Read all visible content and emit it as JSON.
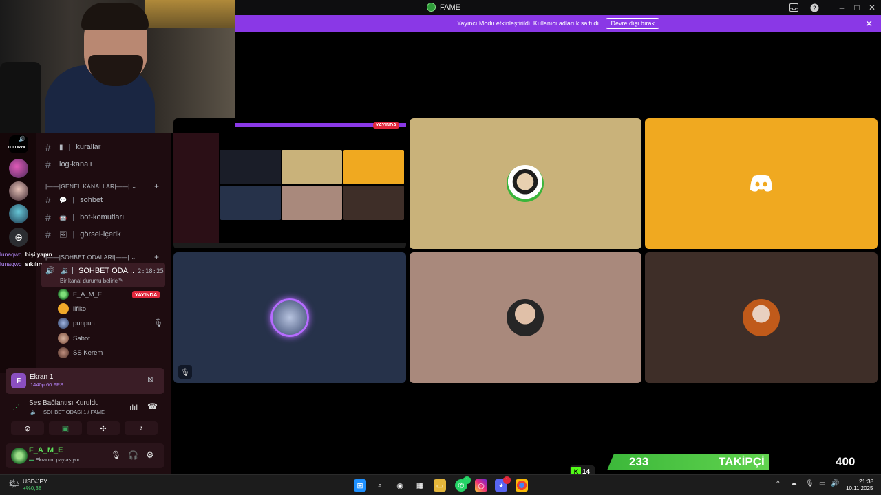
{
  "window": {
    "title": "FAME",
    "banner_text": "Yayıncı Modu etkinleştirildi. Kullanıcı adları kısaltıldı.",
    "banner_button": "Devre dışı bırak"
  },
  "chat": [
    {
      "user": "lunaqwq",
      "message": "bişi yapın"
    },
    {
      "user": "lunaqwq",
      "message": "sıkılırım"
    }
  ],
  "guilds": [
    {
      "label": "TULORYA"
    }
  ],
  "channels": {
    "top": [
      {
        "label": "kurallar",
        "icon": "book-icon"
      },
      {
        "label": "log-kanalı",
        "icon": "hash-icon"
      }
    ],
    "category1": "GENEL KANALLAR",
    "general": [
      {
        "label": "sohbet",
        "icon": "chat-bubble-icon"
      },
      {
        "label": "bot-komutları",
        "icon": "robot-icon"
      },
      {
        "label": "görsel-içerik",
        "icon": "image-icon"
      }
    ],
    "category2": "SOHBET ODALARI",
    "voice": {
      "label": "SOHBET ODA...",
      "timer": "2:18:25",
      "status_hint": "Bir kanal durumu belirle"
    }
  },
  "voice_users": [
    {
      "name": "F_A_M_E",
      "live": "YAYINDA"
    },
    {
      "name": "lifiko"
    },
    {
      "name": "punpun",
      "muted": true
    },
    {
      "name": "Sabot"
    },
    {
      "name": "SS Kerem"
    }
  ],
  "stream_panel": {
    "title": "Ekran 1",
    "quality": "1440p 60 FPS"
  },
  "connection": {
    "status": "Ses Bağlantısı Kuruldu",
    "channel": "SOHBET ODASI 1 / FAME"
  },
  "user_panel": {
    "name": "F_A_M_E",
    "status": "Ekranını paylaşıyor"
  },
  "stage": {
    "live_badge": "YAYINDA"
  },
  "overlay": {
    "followers": "233",
    "label": "TAKİPÇİ",
    "goal": "400",
    "kick_badge": "14"
  },
  "taskbar": {
    "ticker": "USD/JPY",
    "ticker_change": "+%0,38",
    "time": "21:38",
    "date": "10.11.2025",
    "badges": {
      "whatsapp": "1",
      "discord": "1"
    }
  },
  "colors": {
    "accent": "#8a38e6",
    "live": "#e0283c",
    "follow_green": "#53c144"
  }
}
